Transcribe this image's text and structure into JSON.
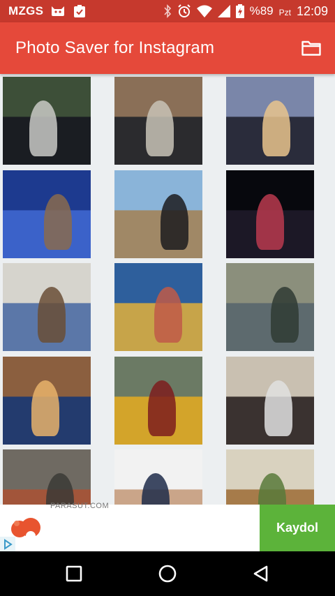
{
  "status_bar": {
    "carrier": "MZGS",
    "battery": "%89",
    "period": "Pzt",
    "time": "12:09",
    "icons": [
      "cat-icon",
      "clipboard-icon",
      "bluetooth-icon",
      "alarm-icon",
      "wifi-icon",
      "signal-icon",
      "battery-icon"
    ]
  },
  "app_bar": {
    "title": "Photo Saver for Instagram",
    "action_icon": "folder-icon"
  },
  "photos": [
    {
      "alt": "man standing by black car",
      "colors": [
        "#3d4f38",
        "#1a1d22",
        "#c9c9c5"
      ]
    },
    {
      "alt": "two men sitting on bench",
      "colors": [
        "#8a6f57",
        "#2b2b2e",
        "#c8c3b6"
      ]
    },
    {
      "alt": "family at birthday party",
      "colors": [
        "#7a86a9",
        "#2a2c3b",
        "#e9c48d"
      ]
    },
    {
      "alt": "group dinner blue light",
      "colors": [
        "#1d3a8f",
        "#3b62c9",
        "#8a6b4d"
      ]
    },
    {
      "alt": "man in front of cathedral",
      "colors": [
        "#8ab4d9",
        "#a08866",
        "#1c1c1f"
      ]
    },
    {
      "alt": "river at night",
      "colors": [
        "#07080d",
        "#1c1826",
        "#b83a4f"
      ]
    },
    {
      "alt": "man at table",
      "colors": [
        "#d6d4cd",
        "#5b77a8",
        "#6a4d36"
      ]
    },
    {
      "alt": "man before golden church",
      "colors": [
        "#2e5f9c",
        "#c7a449",
        "#c05b48"
      ]
    },
    {
      "alt": "people on city viewpoint",
      "colors": [
        "#8b8f7c",
        "#5d6a6e",
        "#2f3b34"
      ]
    },
    {
      "alt": "baby sitting in chair",
      "colors": [
        "#8b5f3f",
        "#233b6e",
        "#e7b36b"
      ]
    },
    {
      "alt": "man on yellow motorcycle",
      "colors": [
        "#6b7a64",
        "#d3a42a",
        "#7d1d1d"
      ]
    },
    {
      "alt": "couple selfie",
      "colors": [
        "#c9c0b1",
        "#3a3230",
        "#e0e0e0"
      ]
    },
    {
      "alt": "street market",
      "colors": [
        "#6f6a62",
        "#a2553a",
        "#3b3a36"
      ]
    },
    {
      "alt": "baby portrait",
      "colors": [
        "#f2f2f2",
        "#caa589",
        "#1f2b4a"
      ]
    },
    {
      "alt": "stone building with door",
      "colors": [
        "#d9d2bf",
        "#a67b4a",
        "#587a3a"
      ]
    }
  ],
  "ad": {
    "site": "PARASUT.COM",
    "cta": "Kaydol",
    "logo_color": "#e8542f"
  },
  "nav_bar": {
    "buttons": [
      "recents-square-icon",
      "home-circle-icon",
      "back-triangle-icon"
    ]
  },
  "colors": {
    "status_bar": "#c6392d",
    "app_bar": "#e5493a",
    "cta": "#5cb33a"
  }
}
